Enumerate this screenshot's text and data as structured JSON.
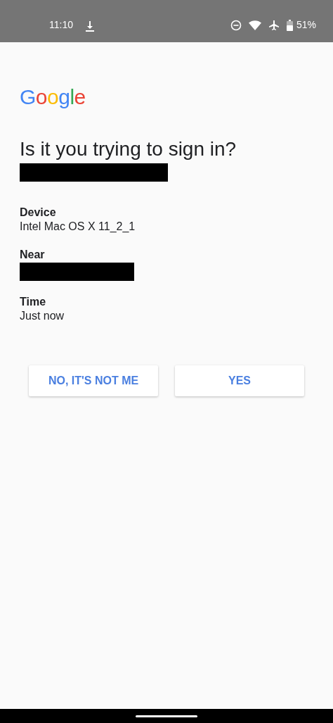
{
  "status_bar": {
    "time": "11:10",
    "battery": "51%"
  },
  "logo": "Google",
  "title": "Is it you trying to sign in?",
  "account": {
    "redacted": true
  },
  "details": [
    {
      "label": "Device",
      "value": "Intel Mac OS X 11_2_1",
      "redacted": false
    },
    {
      "label": "Near",
      "redacted": true
    },
    {
      "label": "Time",
      "value": "Just now",
      "redacted": false
    }
  ],
  "buttons": [
    "NO, IT'S NOT ME",
    "YES"
  ]
}
